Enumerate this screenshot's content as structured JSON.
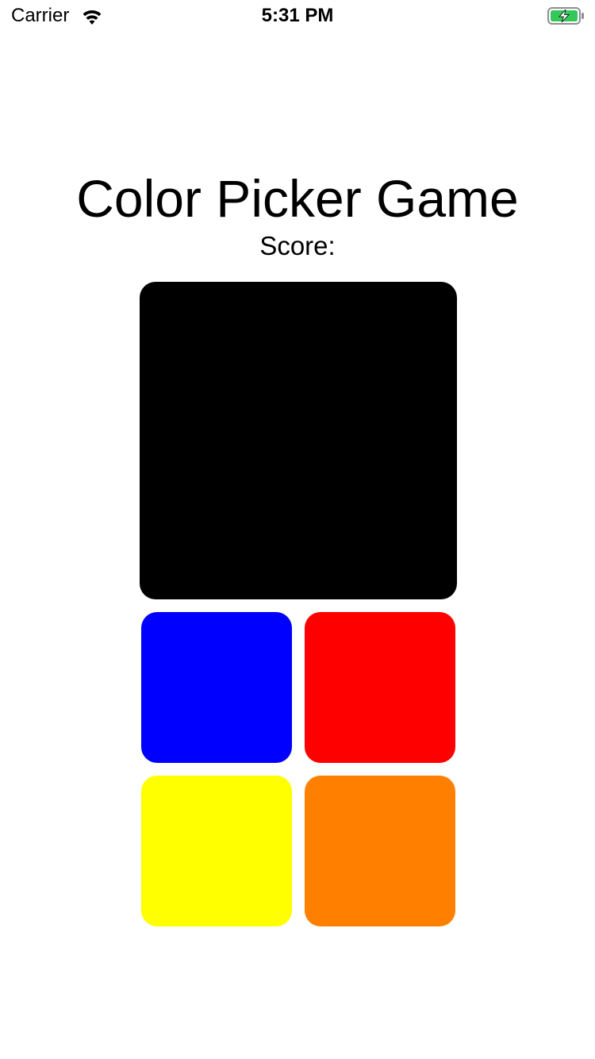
{
  "status_bar": {
    "carrier": "Carrier",
    "time": "5:31 PM",
    "wifi_icon": "wifi-icon",
    "battery_icon": "battery-charging-icon",
    "battery_color": "#34c759"
  },
  "game": {
    "title": "Color Picker Game",
    "score_label": "Score:",
    "target_color": "#000000",
    "options": [
      {
        "name": "blue",
        "color": "#0000ff"
      },
      {
        "name": "red",
        "color": "#ff0000"
      },
      {
        "name": "yellow",
        "color": "#ffff00"
      },
      {
        "name": "orange",
        "color": "#ff8000"
      }
    ]
  }
}
